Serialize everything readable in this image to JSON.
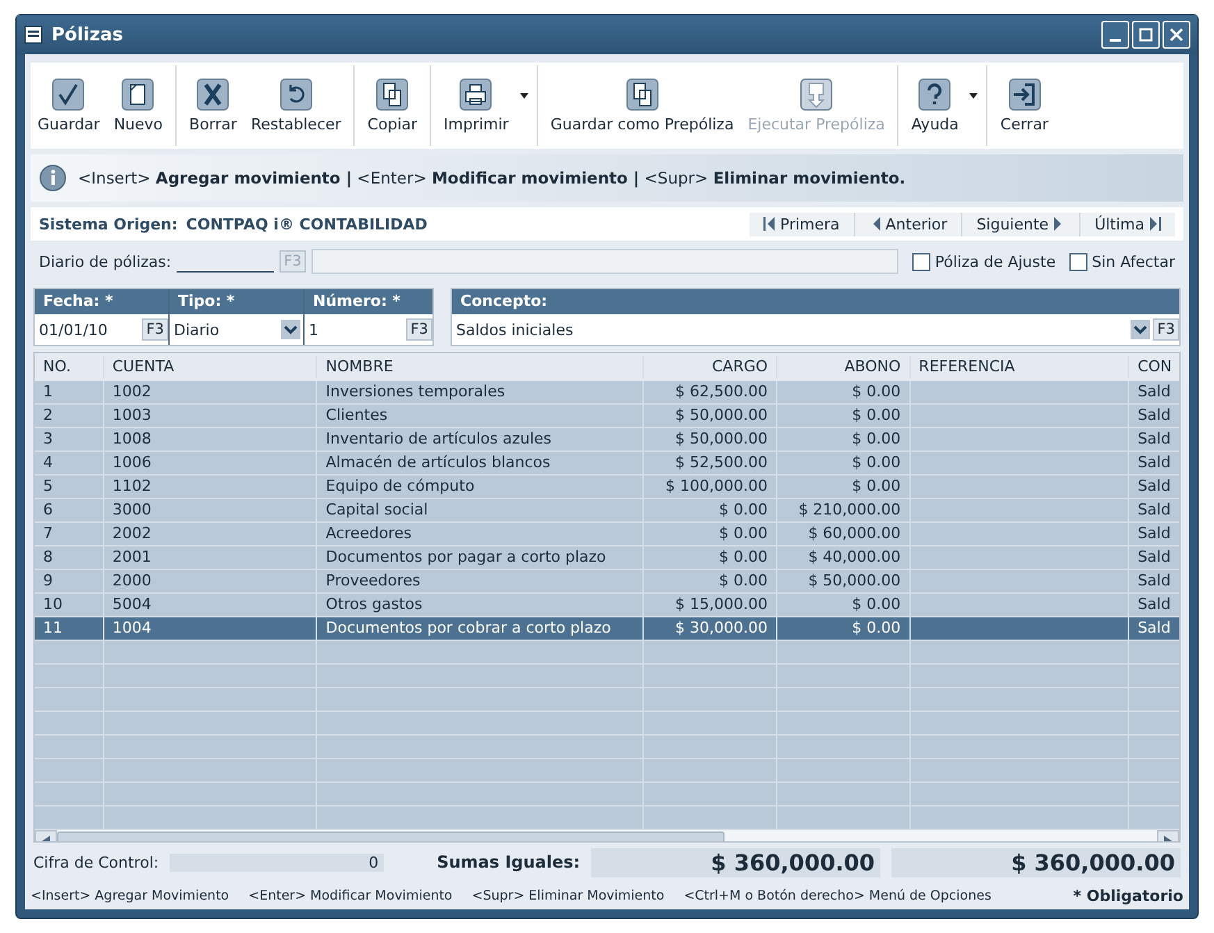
{
  "window": {
    "title": "Pólizas"
  },
  "toolbar": [
    {
      "label": "Guardar",
      "disabled": false,
      "dropdown": false,
      "group_start": false
    },
    {
      "label": "Nuevo",
      "disabled": false,
      "dropdown": false,
      "group_start": false
    },
    {
      "label": "Borrar",
      "disabled": false,
      "dropdown": false,
      "group_start": true
    },
    {
      "label": "Restablecer",
      "disabled": false,
      "dropdown": false,
      "group_start": false
    },
    {
      "label": "Copiar",
      "disabled": false,
      "dropdown": false,
      "group_start": true
    },
    {
      "label": "Imprimir",
      "disabled": false,
      "dropdown": true,
      "group_start": true
    },
    {
      "label": "Guardar como Prepóliza",
      "disabled": false,
      "dropdown": false,
      "group_start": true
    },
    {
      "label": "Ejecutar Prepóliza",
      "disabled": true,
      "dropdown": false,
      "group_start": false
    },
    {
      "label": "Ayuda",
      "disabled": false,
      "dropdown": true,
      "group_start": true
    },
    {
      "label": "Cerrar",
      "disabled": false,
      "dropdown": false,
      "group_start": true
    }
  ],
  "info_bar": "<Insert> **Agregar movimiento |** <Enter> **Modificar movimiento |** <Supr> **Eliminar movimiento.**",
  "origin": {
    "label": "Sistema Origen:",
    "value": "CONTPAQ i® CONTABILIDAD"
  },
  "navigation": [
    {
      "label": "Primera"
    },
    {
      "label": "Anterior"
    },
    {
      "label": "Siguiente"
    },
    {
      "label": "Última"
    }
  ],
  "diario": {
    "label": "Diario de pólizas:",
    "key": "F3"
  },
  "checkboxes": [
    {
      "label": "Póliza de Ajuste",
      "checked": false
    },
    {
      "label": "Sin Afectar",
      "checked": false
    }
  ],
  "fields": [
    {
      "label": "Fecha: *",
      "value": "01/01/10",
      "kind": "key",
      "key": "F3"
    },
    {
      "label": "Tipo: *",
      "value": "Diario",
      "kind": "select"
    },
    {
      "label": "Número: *",
      "value": "1",
      "kind": "key",
      "key": "F3"
    }
  ],
  "concepto": {
    "label": "Concepto:",
    "value": "Saldos iniciales",
    "key": "F3"
  },
  "table": {
    "columns": [
      "NO.",
      "CUENTA",
      "NOMBRE",
      "CARGO",
      "ABONO",
      "REFERENCIA",
      "CON"
    ],
    "rows": [
      {
        "cells": [
          "1",
          "1002",
          "Inversiones temporales",
          "$ 62,500.00",
          "$ 0.00",
          "",
          "Sald"
        ],
        "selected": false
      },
      {
        "cells": [
          "2",
          "1003",
          "Clientes",
          "$ 50,000.00",
          "$ 0.00",
          "",
          "Sald"
        ],
        "selected": false
      },
      {
        "cells": [
          "3",
          "1008",
          "Inventario de artículos azules",
          "$ 50,000.00",
          "$ 0.00",
          "",
          "Sald"
        ],
        "selected": false
      },
      {
        "cells": [
          "4",
          "1006",
          "Almacén de artículos blancos",
          "$ 52,500.00",
          "$ 0.00",
          "",
          "Sald"
        ],
        "selected": false
      },
      {
        "cells": [
          "5",
          "1102",
          "Equipo de cómputo",
          "$ 100,000.00",
          "$ 0.00",
          "",
          "Sald"
        ],
        "selected": false
      },
      {
        "cells": [
          "6",
          "3000",
          "Capital social",
          "$ 0.00",
          "$ 210,000.00",
          "",
          "Sald"
        ],
        "selected": false
      },
      {
        "cells": [
          "7",
          "2002",
          "Acreedores",
          "$ 0.00",
          "$ 60,000.00",
          "",
          "Sald"
        ],
        "selected": false
      },
      {
        "cells": [
          "8",
          "2001",
          "Documentos por pagar a corto plazo",
          "$ 0.00",
          "$ 40,000.00",
          "",
          "Sald"
        ],
        "selected": false
      },
      {
        "cells": [
          "9",
          "2000",
          "Proveedores",
          "$ 0.00",
          "$ 50,000.00",
          "",
          "Sald"
        ],
        "selected": false
      },
      {
        "cells": [
          "10",
          "5004",
          "Otros gastos",
          "$ 15,000.00",
          "$ 0.00",
          "",
          "Sald"
        ],
        "selected": false
      },
      {
        "cells": [
          "11",
          "1004",
          "Documentos por cobrar a corto plazo",
          "$ 30,000.00",
          "$ 0.00",
          "",
          "Sald"
        ],
        "selected": true
      }
    ]
  },
  "totals": {
    "control_label": "Cifra de Control:",
    "control_value": "0",
    "sums_label": "Sumas Iguales:",
    "cargo": "$ 360,000.00",
    "abono": "$ 360,000.00"
  },
  "status_bar": {
    "hints": [
      "<Insert> Agregar Movimiento",
      "<Enter> Modificar Movimiento",
      "<Supr> Eliminar Movimiento",
      "<Ctrl+M o Botón derecho> Menú de Opciones"
    ],
    "required": "* Obligatorio"
  }
}
